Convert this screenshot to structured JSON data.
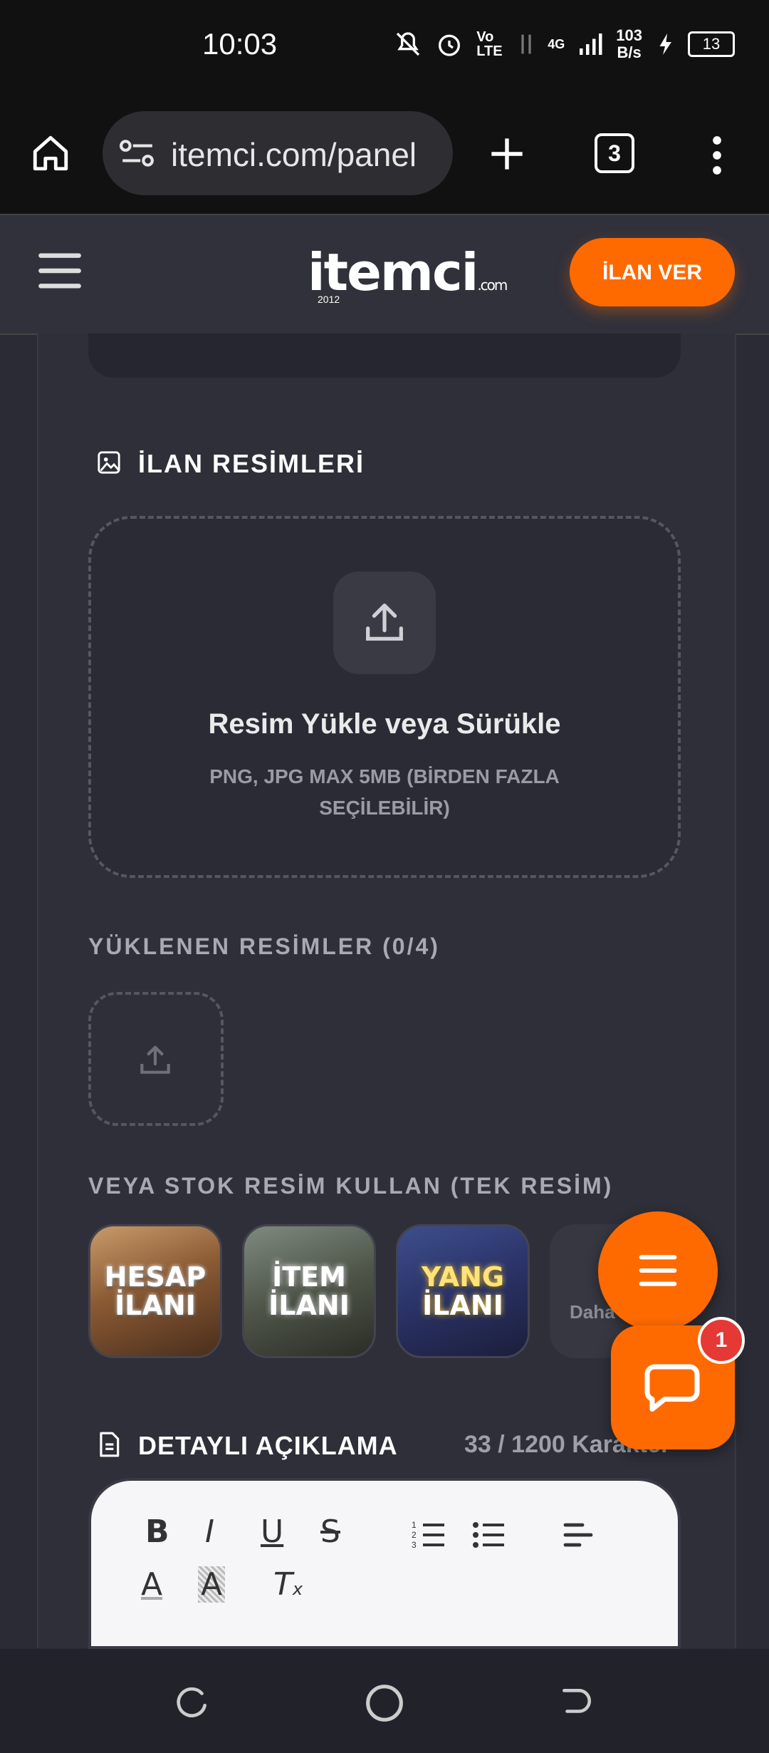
{
  "status_bar": {
    "time": "10:03",
    "network_speed_value": "103",
    "network_speed_unit": "B/s",
    "signal_label": "4G",
    "volte_label": "Vo LTE",
    "battery": "13"
  },
  "browser": {
    "url": "itemci.com/panel",
    "tab_count": "3"
  },
  "site_header": {
    "logo_text": "itemci",
    "logo_suffix": ".com",
    "logo_year": "2012",
    "post_button": "İLAN VER"
  },
  "images_section": {
    "title": "İLAN RESİMLERİ",
    "upload_title": "Resim Yükle veya Sürükle",
    "upload_subtitle": "PNG, JPG MAX 5MB (BİRDEN FAZLA SEÇİLEBİLİR)",
    "uploaded_heading": "YÜKLENEN RESİMLER (0/4)",
    "stock_heading": "VEYA STOK RESİM KULLAN (TEK RESİM)",
    "stock_images": [
      {
        "line1": "HESAP",
        "line2": "İLANI"
      },
      {
        "line1": "İTEM",
        "line2": "İLANI"
      },
      {
        "line1": "YANG",
        "line2": "İLANI"
      }
    ],
    "more_label": "Daha"
  },
  "description": {
    "title": "DETAYLI AÇIKLAMA",
    "counter": "33 / 1200 Karakter"
  },
  "chat": {
    "badge": "1"
  },
  "colors": {
    "accent": "#ff6a00",
    "background": "#2b2b35",
    "panel": "#2f2f39"
  }
}
